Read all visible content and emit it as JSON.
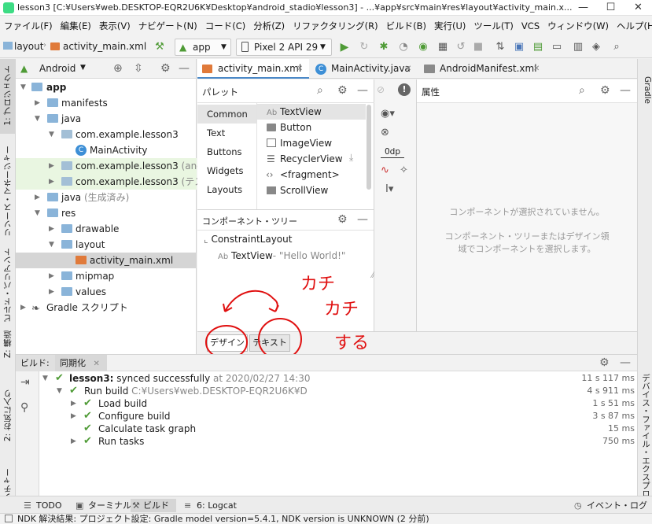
{
  "window": {
    "title": "lesson3 [C:¥Users¥web.DESKTOP-EQR2U6K¥Desktop¥android_stadio¥lesson3] - ...¥app¥src¥main¥res¥layout¥activity_main.x..."
  },
  "menu": [
    "ファイル(F)",
    "編集(E)",
    "表示(V)",
    "ナビゲート(N)",
    "コード(C)",
    "分析(Z)",
    "リファクタリング(R)",
    "ビルド(B)",
    "実行(U)",
    "ツール(T)",
    "VCS",
    "ウィンドウ(W)",
    "ヘルプ(H)"
  ],
  "navbar": {
    "crumb1": "layout",
    "crumb2": "activity_main.xml",
    "run_config": "app",
    "device": "Pixel 2 API 29"
  },
  "left_tabs": {
    "project": "1: プロジェクト",
    "resources": "リソース・マネージャー",
    "variants": "ビルド・バリアント",
    "structure": "Z: 構造",
    "favorites": "2: お気に入り",
    "captures": "ャプチャー"
  },
  "right_tabs": {
    "gradle": "Gradle",
    "device_explorer": "デバイス・ファイル・エクスプローラー"
  },
  "project": {
    "view": "Android",
    "tree": [
      {
        "label": "app",
        "bold": true
      },
      {
        "label": "manifests"
      },
      {
        "label": "java"
      },
      {
        "label": "com.example.lesson3"
      },
      {
        "label": "MainActivity"
      },
      {
        "label": "com.example.lesson3",
        "suffix": " (androidTest)"
      },
      {
        "label": "com.example.lesson3",
        "suffix": " (テスト)"
      },
      {
        "label": "java",
        "suffix": " (生成済み)"
      },
      {
        "label": "res"
      },
      {
        "label": "drawable"
      },
      {
        "label": "layout"
      },
      {
        "label": "activity_main.xml"
      },
      {
        "label": "mipmap"
      },
      {
        "label": "values"
      },
      {
        "label": "Gradle スクリプト"
      }
    ]
  },
  "editor_tabs": [
    "activity_main.xml",
    "MainActivity.java",
    "AndroidManifest.xml"
  ],
  "palette": {
    "title": "パレット",
    "categories": [
      "Common",
      "Text",
      "Buttons",
      "Widgets",
      "Layouts"
    ],
    "items": [
      "TextView",
      "Button",
      "ImageView",
      "RecyclerView",
      "<fragment>",
      "ScrollView"
    ],
    "textview_prefix": "Ab"
  },
  "component_tree": {
    "title": "コンポーネント・ツリー",
    "root": "ConstraintLayout",
    "child": "TextView",
    "child_text": "- \"Hello World!\"",
    "child_prefix": "Ab"
  },
  "canvas_toolbar": {
    "margin": "0dp"
  },
  "attributes": {
    "title": "属性",
    "empty1": "コンポーネントが選択されていません。",
    "empty2": "コンポーネント・ツリーまたはデザイン領",
    "empty3": "域でコンポーネントを選択します。"
  },
  "design_tabs": [
    "デザイン",
    "テキスト"
  ],
  "annotation": {
    "line1": "カチ",
    "line2": "カチ",
    "line3": "する"
  },
  "build": {
    "tabs": [
      "ビルド:",
      "同期化"
    ],
    "rows": [
      {
        "label": "lesson3:",
        "detail": " synced successfully",
        "extra": " at 2020/02/27 14:30",
        "time": "11 s 117 ms"
      },
      {
        "label": "Run build",
        "detail": " C:¥Users¥web.DESKTOP-EQR2U6K¥D",
        "extra": "",
        "time": "4 s 911 ms"
      },
      {
        "label": "Load build",
        "detail": "",
        "extra": "",
        "time": "1 s 51 ms"
      },
      {
        "label": "Configure build",
        "detail": "",
        "extra": "",
        "time": "3 s 87 ms"
      },
      {
        "label": "Calculate task graph",
        "detail": "",
        "extra": "",
        "time": "15 ms"
      },
      {
        "label": "Run tasks",
        "detail": "",
        "extra": "",
        "time": "750 ms"
      }
    ]
  },
  "bottom_tabs": {
    "todo": "TODO",
    "terminal": "ターミナル",
    "build": "ビルド",
    "logcat": "6: Logcat",
    "event_log": "イベント・ログ"
  },
  "status": "NDK 解決結果: プロジェクト設定: Gradle model version=5.4.1, NDK version is UNKNOWN (2 分前)",
  "colors": {
    "accent": "#4f9b36",
    "annotation": "#e01010",
    "selection": "#d5d5d5"
  }
}
